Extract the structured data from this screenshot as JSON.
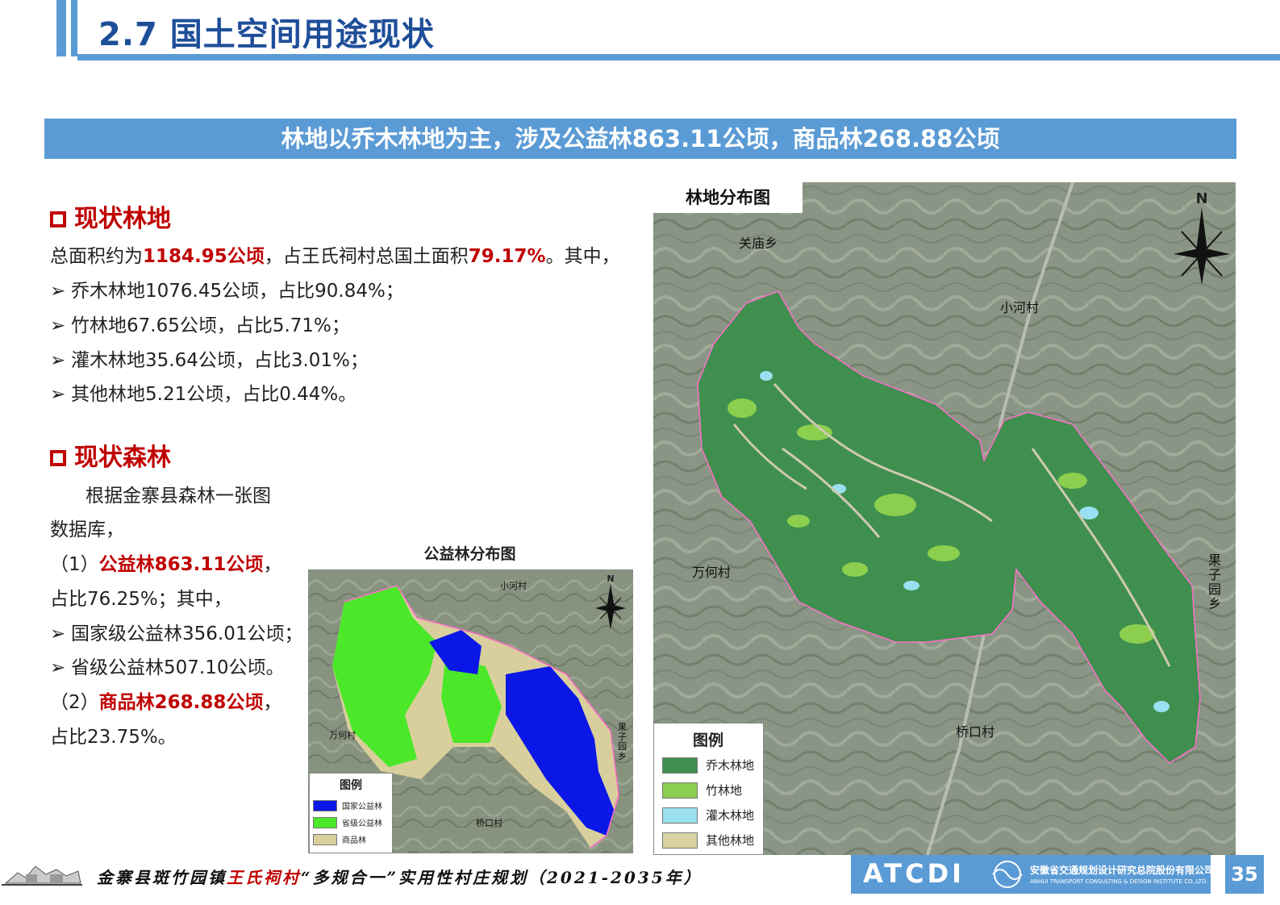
{
  "header": {
    "title": "2.7 国土空间用途现状"
  },
  "banner": {
    "text": "林地以乔木林地为主，涉及公益林863.11公顷，商品林268.88公顷"
  },
  "forest_land": {
    "heading": "现状林地",
    "summary_prefix": "总面积约为",
    "total_area": "1184.95公顷",
    "summary_mid": "，占王氏祠村总国土面积",
    "total_ratio": "79.17%",
    "summary_suffix": "。其中，",
    "items": [
      "乔木林地1076.45公顷，占比90.84%；",
      "竹林地67.65公顷，占比5.71%；",
      "灌木林地35.64公顷，占比3.01%；",
      "其他林地5.21公顷，占比0.44%。"
    ]
  },
  "forest": {
    "heading": "现状森林",
    "line1": "根据金寨县森林一张图",
    "line2": "数据库，",
    "p1_prefix": "（1）",
    "p1_bold": "公益林863.11公顷",
    "p1_suffix": "，",
    "p1_line2": "占比76.25%；其中，",
    "items": [
      "国家级公益林356.01公顷；",
      "省级公益林507.10公顷。"
    ],
    "p2_prefix": "（2）",
    "p2_bold": "商品林268.88公顷",
    "p2_suffix": "，",
    "p2_line2": "占比23.75%。"
  },
  "map_small": {
    "title": "公益林分布图",
    "places": {
      "xiaohe": "小河村",
      "wanhe": "万何村",
      "guozi": "果子园乡",
      "qiaokou": "桥口村"
    },
    "north": "N",
    "legend": {
      "title": "图例",
      "items": [
        {
          "label": "国家公益林",
          "color": "#0a17e6"
        },
        {
          "label": "省级公益林",
          "color": "#4be82a"
        },
        {
          "label": "商品林",
          "color": "#d9cf9c"
        }
      ]
    }
  },
  "map_large": {
    "title": "林地分布图",
    "places": {
      "guanmiao": "关庙乡",
      "xiaohe": "小河村",
      "wanhe": "万何村",
      "guozi": "果子园乡",
      "qiaokou": "桥口村"
    },
    "north": "N",
    "legend": {
      "title": "图例",
      "items": [
        {
          "label": "乔木林地",
          "color": "#3f8f4f"
        },
        {
          "label": "竹林地",
          "color": "#8ccf4f"
        },
        {
          "label": "灌木林地",
          "color": "#9be0f0"
        },
        {
          "label": "其他林地",
          "color": "#d8d3a0"
        }
      ]
    }
  },
  "footer": {
    "part1": "金寨县斑竹园镇",
    "part2": "王氏祠村",
    "part3": "“多规合一”实用性村庄规划（2021-2035年）",
    "logo_text": "ATCDI",
    "company_cn": "安徽省交通规划设计研究总院股份有限公司",
    "company_en": "ANHUI TRANSPORT CONSULTING & DESIGN INSTITUTE CO.,LTD.",
    "page": "35"
  }
}
